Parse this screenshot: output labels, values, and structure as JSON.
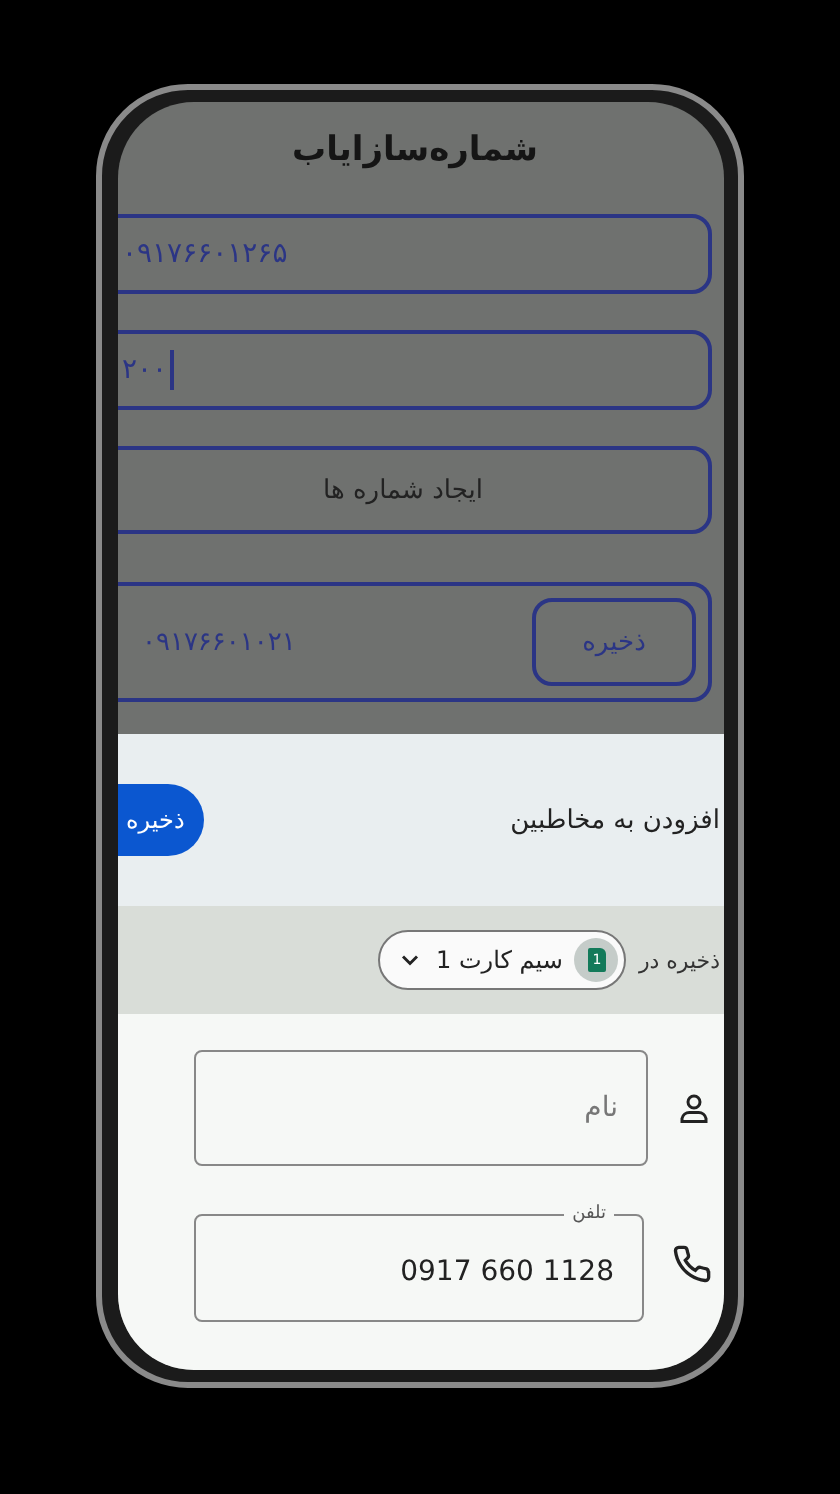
{
  "app": {
    "title": "شماره‌سازایاب",
    "fields": [
      {
        "value": "۰۹۱۷۶۶۰۱۲۶۵",
        "focused": false
      },
      {
        "value": "۲۰۰",
        "focused": true
      }
    ],
    "generate_button": "ایجاد شماره ها",
    "results": [
      {
        "number": "۰۹۱۷۶۶۰۱۰۲۱",
        "save_label": "ذخیره"
      }
    ]
  },
  "sheet": {
    "title": "افزودن به مخاطبین",
    "save_button": "ذخیره",
    "save_in": {
      "label": "ذخیره در",
      "sim_badge": "1",
      "account": "سیم کارت 1"
    },
    "fields": [
      {
        "kind": "name",
        "placeholder": "نام"
      },
      {
        "kind": "phone",
        "label": "تلفن",
        "value": "0917 660 1128"
      }
    ]
  }
}
